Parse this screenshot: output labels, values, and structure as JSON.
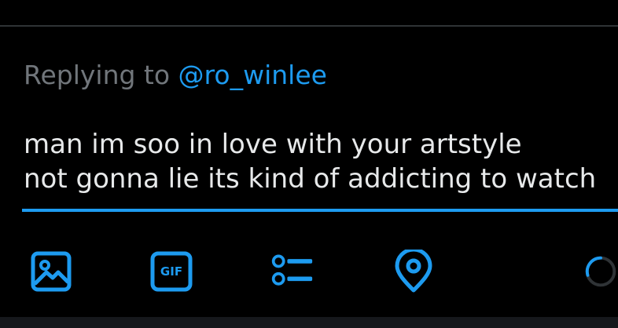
{
  "reply": {
    "prefix": "Replying to",
    "handle": "@ro_winlee"
  },
  "compose": {
    "lines": [
      "man im soo in love with your artstyle",
      "not gonna lie its kind of addicting to watch"
    ]
  },
  "toolbar": {
    "icons": [
      "image-icon",
      "gif-icon",
      "poll-icon",
      "location-icon",
      "character-count-icon"
    ],
    "gif_label": "GIF"
  },
  "colors": {
    "accent": "#1d9bf0",
    "text": "#e7e9ea",
    "muted": "#71767b",
    "background": "#000000"
  }
}
